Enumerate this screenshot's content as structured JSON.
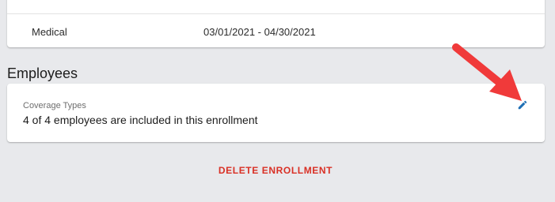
{
  "coverage": {
    "name": "Medical",
    "dates": "03/01/2021 - 04/30/2021"
  },
  "employees_section": {
    "title": "Employees",
    "label": "Coverage Types",
    "value": "4 of 4 employees are included in this enrollment",
    "edit_icon": "pencil-icon"
  },
  "actions": {
    "delete_label": "DELETE ENROLLMENT"
  },
  "colors": {
    "background": "#e8e9ec",
    "accent_blue": "#1f6fb4",
    "delete_red": "#d93025",
    "annotation_arrow": "#f03a3a"
  }
}
